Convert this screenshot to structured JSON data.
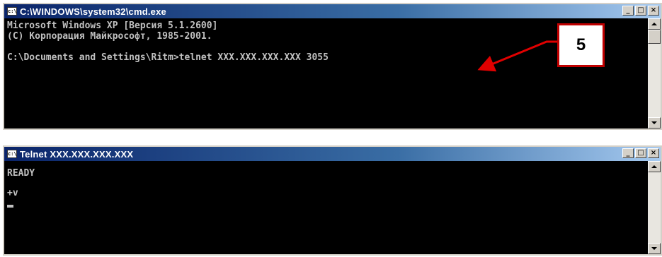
{
  "cmd_window": {
    "title": "C:\\WINDOWS\\system32\\cmd.exe",
    "lines": [
      "Microsoft Windows XP [Версия 5.1.2600]",
      "(С) Корпорация Майкрософт, 1985-2001.",
      "",
      "C:\\Documents and Settings\\Ritm>telnet XXX.XXX.XXX.XXX 3055"
    ]
  },
  "telnet_window": {
    "title": "Telnet XXX.XXX.XXX.XXX",
    "lines": [
      "READY",
      "+v"
    ]
  },
  "window_controls": {
    "minimize": "_",
    "maximize": "□",
    "close": "×"
  },
  "callout": {
    "label": "5",
    "color": "#c00000"
  },
  "colors": {
    "titlebar_start": "#0a246a",
    "titlebar_end": "#a6caf0",
    "console_bg": "#000000",
    "console_text": "#c0c0c0"
  }
}
